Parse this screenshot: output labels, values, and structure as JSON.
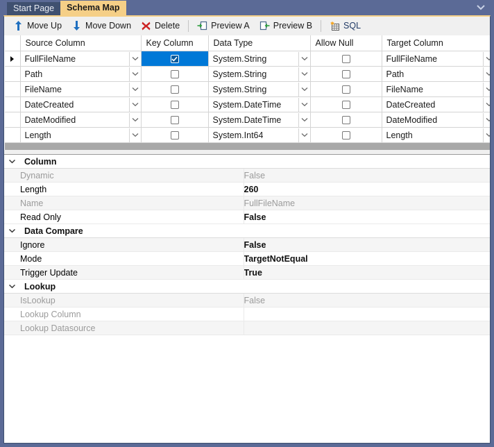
{
  "window": {
    "tabs": [
      {
        "label": "Start Page",
        "active": false
      },
      {
        "label": "Schema Map",
        "active": true
      }
    ],
    "overflow_icon": "chevron-down-icon"
  },
  "toolbar": {
    "buttons": [
      {
        "label": "Move Up",
        "icon": "arrow-up-icon"
      },
      {
        "label": "Move Down",
        "icon": "arrow-down-icon"
      },
      {
        "label": "Delete",
        "icon": "red-x-icon"
      },
      {
        "label": "Preview A",
        "icon": "preview-a-icon"
      },
      {
        "label": "Preview B",
        "icon": "preview-b-icon"
      },
      {
        "label": "SQL",
        "icon": "sql-table-icon"
      }
    ]
  },
  "grid": {
    "columns": [
      "Source Column",
      "Key Column",
      "Data Type",
      "Allow Null",
      "Target Column"
    ],
    "rows": [
      {
        "source": "FullFileName",
        "key": true,
        "type": "System.String",
        "allow_null": false,
        "target": "FullFileName",
        "selected": true
      },
      {
        "source": "Path",
        "key": false,
        "type": "System.String",
        "allow_null": false,
        "target": "Path",
        "selected": false
      },
      {
        "source": "FileName",
        "key": false,
        "type": "System.String",
        "allow_null": false,
        "target": "FileName",
        "selected": false
      },
      {
        "source": "DateCreated",
        "key": false,
        "type": "System.DateTime",
        "allow_null": false,
        "target": "DateCreated",
        "selected": false
      },
      {
        "source": "DateModified",
        "key": false,
        "type": "System.DateTime",
        "allow_null": false,
        "target": "DateModified",
        "selected": false
      },
      {
        "source": "Length",
        "key": false,
        "type": "System.Int64",
        "allow_null": false,
        "target": "Length",
        "selected": false
      }
    ]
  },
  "properties": [
    {
      "kind": "category",
      "name": "Column"
    },
    {
      "kind": "prop",
      "name": "Dynamic",
      "value": "False",
      "disabled": true
    },
    {
      "kind": "prop",
      "name": "Length",
      "value": "260",
      "disabled": false
    },
    {
      "kind": "prop",
      "name": "Name",
      "value": "FullFileName",
      "disabled": true
    },
    {
      "kind": "prop",
      "name": "Read Only",
      "value": "False",
      "disabled": false
    },
    {
      "kind": "category",
      "name": "Data Compare"
    },
    {
      "kind": "prop",
      "name": "Ignore",
      "value": "False",
      "disabled": false
    },
    {
      "kind": "prop",
      "name": "Mode",
      "value": "TargetNotEqual",
      "disabled": false
    },
    {
      "kind": "prop",
      "name": "Trigger Update",
      "value": "True",
      "disabled": false
    },
    {
      "kind": "category",
      "name": "Lookup"
    },
    {
      "kind": "prop",
      "name": "IsLookup",
      "value": "False",
      "disabled": true
    },
    {
      "kind": "prop",
      "name": "Lookup Column",
      "value": "",
      "disabled": true
    },
    {
      "kind": "prop",
      "name": "Lookup Datasource",
      "value": "",
      "disabled": true
    }
  ],
  "colors": {
    "title_bar": "#5b6a96",
    "active_tab": "#f5cf87",
    "inactive_tab": "#3f5070",
    "selection": "#0078d7",
    "grid_background": "#a8a8a8"
  }
}
